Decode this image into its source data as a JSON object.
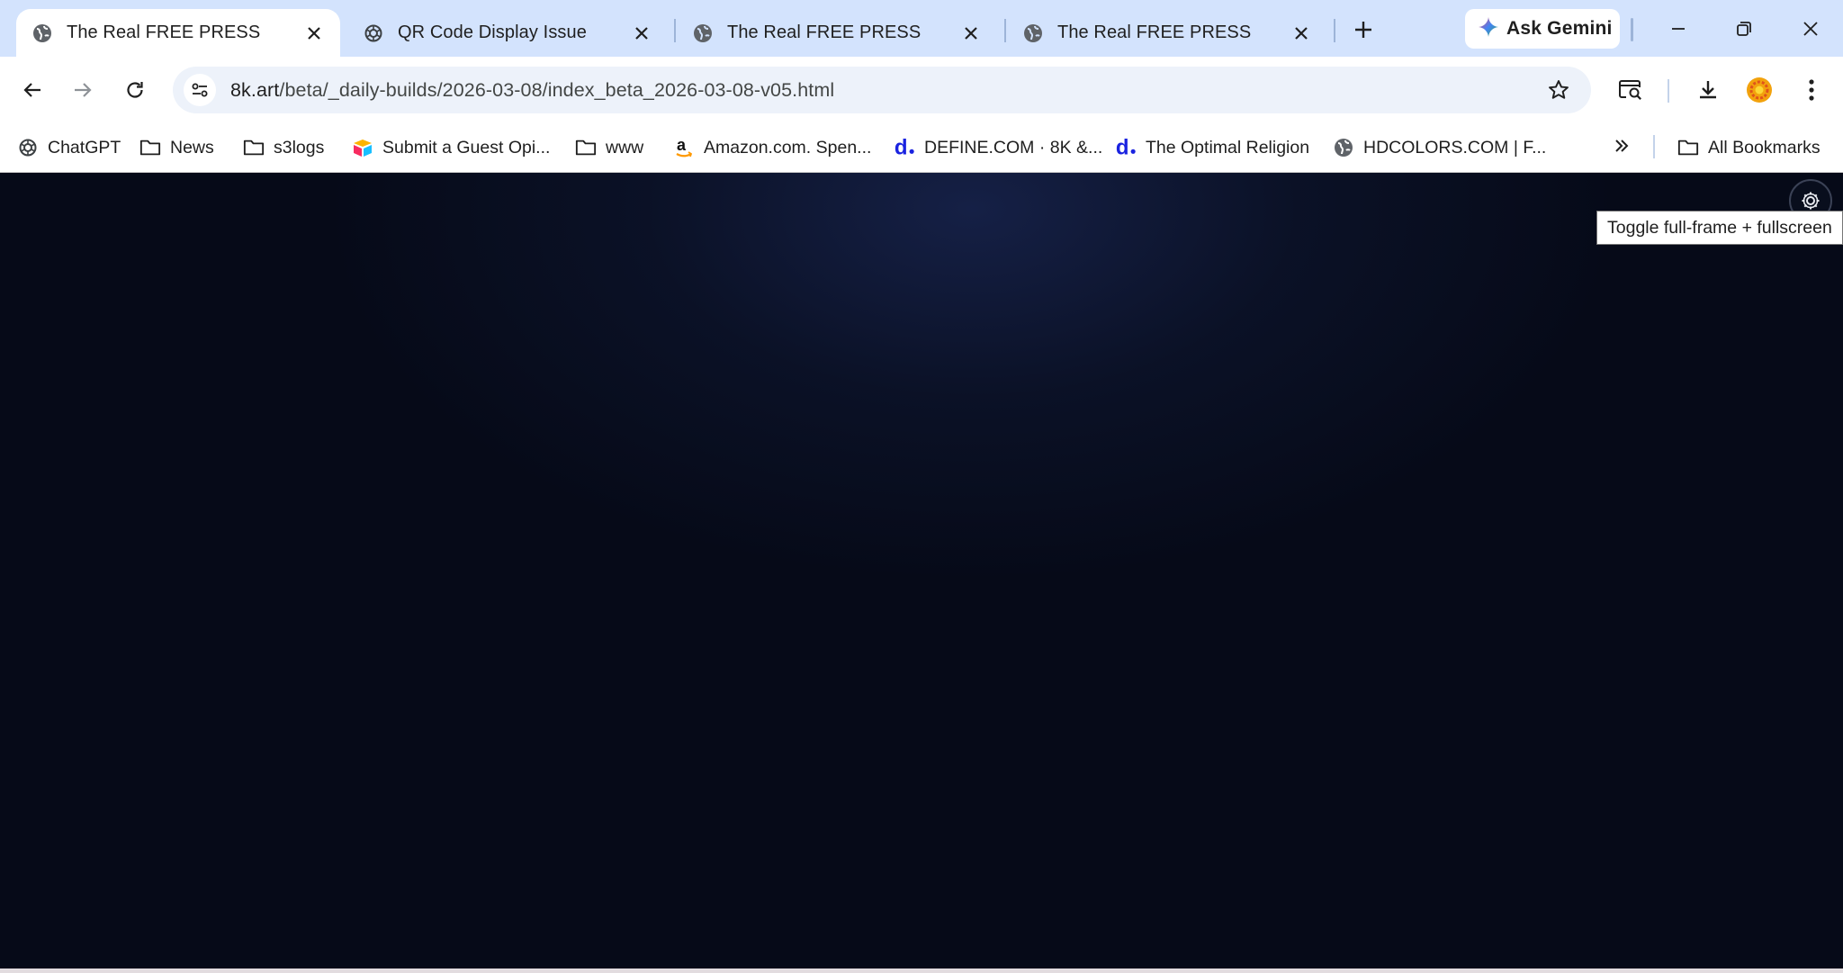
{
  "tabs": [
    {
      "title": "The Real FREE PRESS",
      "icon": "globe-icon",
      "active": true
    },
    {
      "title": "QR Code Display Issue",
      "icon": "chatgpt-icon",
      "active": false
    },
    {
      "title": "The Real FREE PRESS",
      "icon": "globe-icon",
      "active": false
    },
    {
      "title": "The Real FREE PRESS",
      "icon": "globe-icon",
      "active": false
    }
  ],
  "gemini": {
    "label": "Ask Gemini"
  },
  "address": {
    "host": "8k.art",
    "path": "/beta/_daily-builds/2026-03-08/index_beta_2026-03-08-v05.html"
  },
  "bookmarks": [
    {
      "label": "ChatGPT",
      "icon": "chatgpt-icon"
    },
    {
      "label": "News",
      "icon": "folder-icon"
    },
    {
      "label": "s3logs",
      "icon": "folder-icon"
    },
    {
      "label": "Submit a Guest Opi...",
      "icon": "airtable-icon"
    },
    {
      "label": "www",
      "icon": "folder-icon"
    },
    {
      "label": "Amazon.com. Spen...",
      "icon": "amazon-icon"
    },
    {
      "label": "DEFINE.COM · 8K &...",
      "icon": "define-d-icon"
    },
    {
      "label": "The Optimal Religion",
      "icon": "define-d-icon"
    },
    {
      "label": "HDCOLORS.COM | F...",
      "icon": "globe-icon"
    }
  ],
  "all_bookmarks": {
    "label": "All Bookmarks"
  },
  "page": {
    "tooltip": "Toggle full-frame + fullscreen",
    "background_color": "#060a18"
  },
  "colors": {
    "tabstrip": "#d3e3fd",
    "omnibox": "#edf2fa",
    "define_blue": "#1a23e0"
  }
}
